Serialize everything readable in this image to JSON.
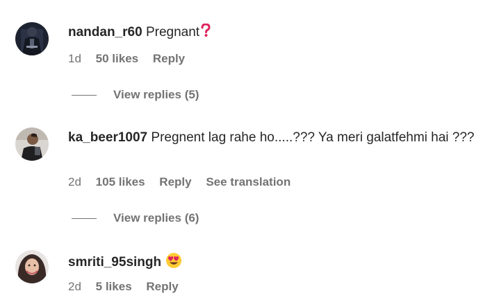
{
  "comments": [
    {
      "username": "nandan_r60",
      "text": "Pregnant",
      "emoji": "red-question-mark",
      "time": "1d",
      "likes": "50 likes",
      "reply": "Reply",
      "view_replies": "View replies (5)"
    },
    {
      "username": "ka_beer1007",
      "text": "Pregnent lag rahe ho.....??? Ya meri galatfehmi hai ???",
      "time": "2d",
      "likes": "105 likes",
      "reply": "Reply",
      "translation": "See translation",
      "view_replies": "View replies (6)"
    },
    {
      "username": "smriti_95singh",
      "text": "",
      "emoji": "heart-eyes-face",
      "time": "2d",
      "likes": "5 likes",
      "reply": "Reply"
    }
  ],
  "colors": {
    "text": "#262626",
    "secondary": "#737373",
    "question_mark": "#e0245e",
    "emoji_face": "#ffcc33",
    "emoji_heart": "#e0245e"
  }
}
